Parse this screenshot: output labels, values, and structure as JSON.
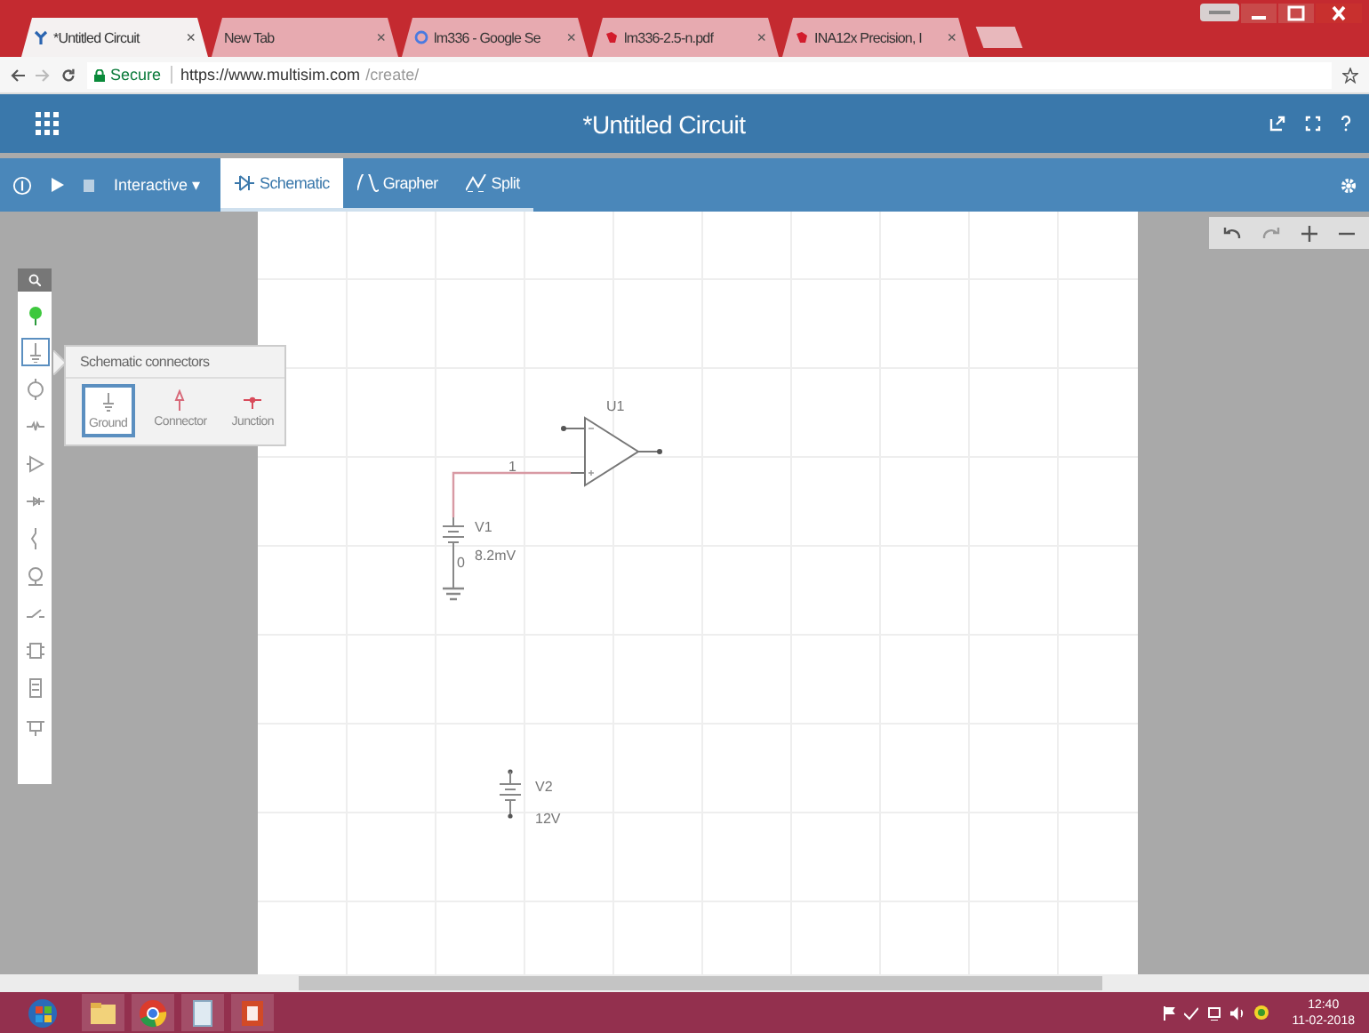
{
  "browser": {
    "tabs": [
      {
        "title": "*Untitled Circuit",
        "close": "×",
        "selected": true
      },
      {
        "title": "New Tab",
        "close": "×",
        "selected": false
      },
      {
        "title": "lm336 - Google Se",
        "close": "×",
        "selected": false
      },
      {
        "title": "lm336-2.5-n.pdf",
        "close": "×",
        "selected": false
      },
      {
        "title": "INA12x Precision, I",
        "close": "×",
        "selected": false
      }
    ],
    "secure": "Secure",
    "url_host": "https://www.multisim.com",
    "url_path": "/create/"
  },
  "app": {
    "title": "*Untitled Circuit"
  },
  "toolbar": {
    "mode": "Interactive ▾",
    "views": [
      {
        "label": "Schematic",
        "selected": true
      },
      {
        "label": "Grapher",
        "selected": false
      },
      {
        "label": "Split",
        "selected": false
      }
    ]
  },
  "palette": [
    {
      "kind": "source",
      "selected": false
    },
    {
      "kind": "ground",
      "selected": true
    },
    {
      "kind": "meter",
      "selected": false
    },
    {
      "kind": "resistor",
      "selected": false
    },
    {
      "kind": "opamp",
      "selected": false
    },
    {
      "kind": "diode",
      "selected": false
    },
    {
      "kind": "inductor",
      "selected": false
    },
    {
      "kind": "lamp",
      "selected": false
    },
    {
      "kind": "switch",
      "selected": false
    },
    {
      "kind": "chip",
      "selected": false
    },
    {
      "kind": "logic",
      "selected": false
    },
    {
      "kind": "mixed",
      "selected": false
    }
  ],
  "popup": {
    "title": "Schematic connectors",
    "items": [
      {
        "label": "Ground",
        "kind": "ground",
        "selected": true
      },
      {
        "label": "Connector",
        "kind": "connector",
        "selected": false
      },
      {
        "label": "Junction",
        "kind": "junction",
        "selected": false
      }
    ]
  },
  "schematic": {
    "opamp_label": "U1",
    "net_label": "1",
    "v1_label": "V1",
    "v1_value": "8.2mV",
    "node_label": "0",
    "v2_label": "V2",
    "v2_value": "12V"
  },
  "taskbar": {
    "time": "12:40",
    "date": "11-02-2018"
  }
}
